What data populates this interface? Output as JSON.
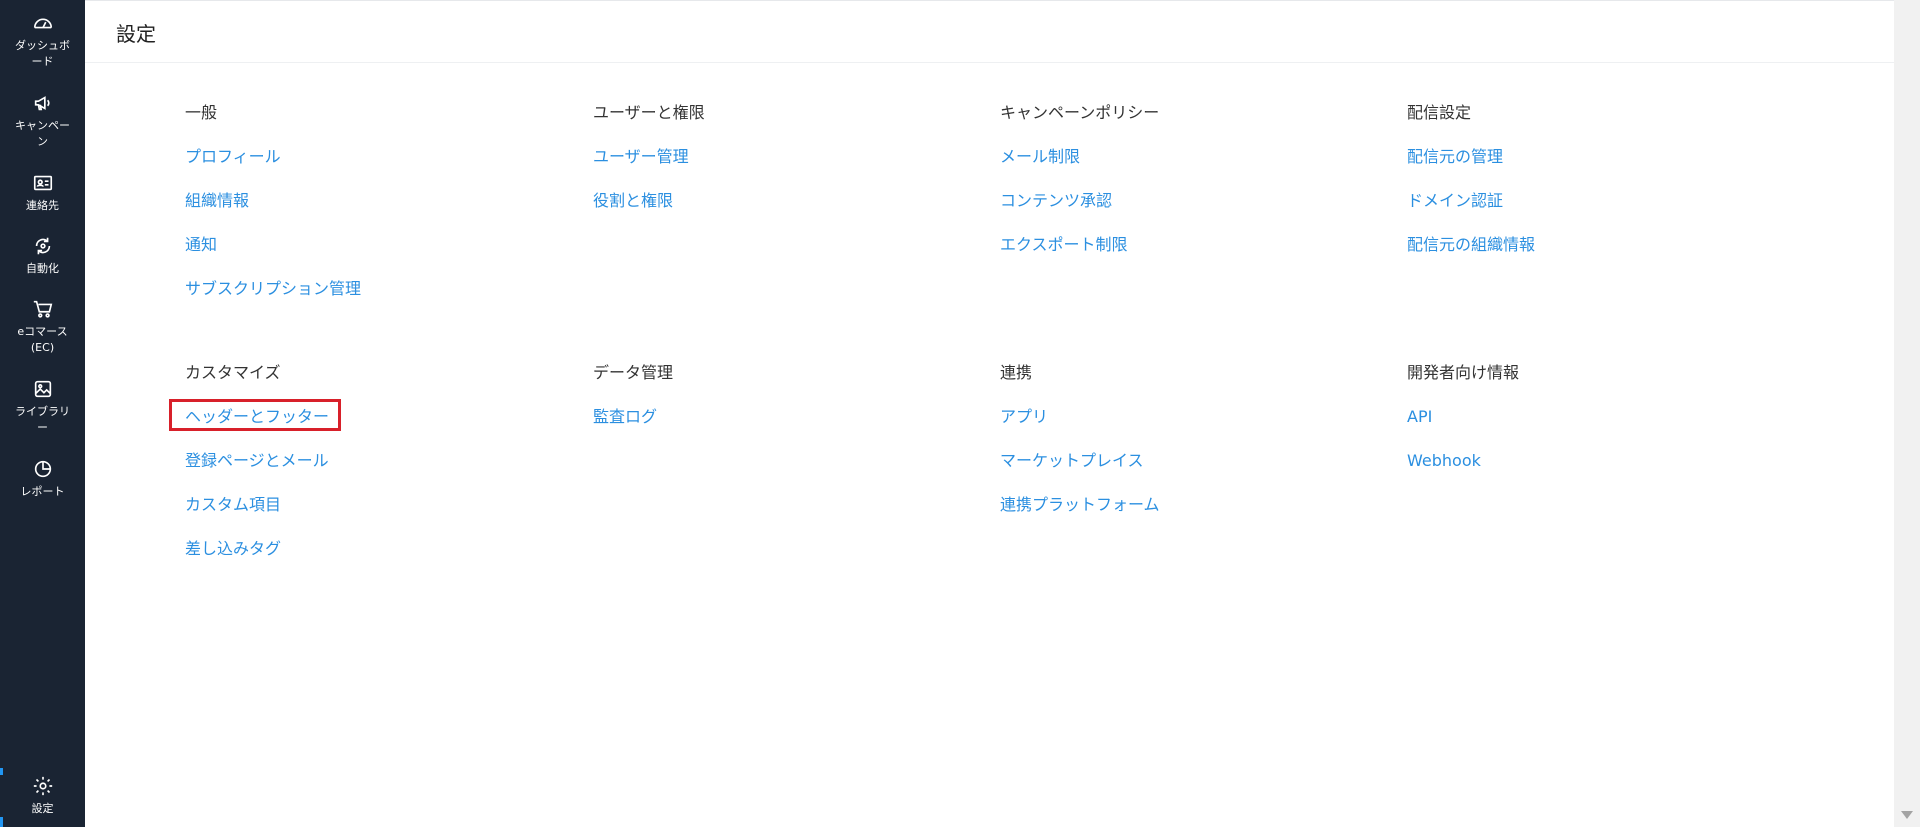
{
  "sidebar": {
    "items": [
      {
        "label": "ダッシュボード",
        "icon": "gauge-icon"
      },
      {
        "label": "キャンペーン",
        "icon": "megaphone-icon"
      },
      {
        "label": "連絡先",
        "icon": "contact-card-icon"
      },
      {
        "label": "自動化",
        "icon": "automation-icon"
      },
      {
        "label": "eコマース (EC)",
        "icon": "cart-icon"
      },
      {
        "label": "ライブラリー",
        "icon": "image-library-icon"
      },
      {
        "label": "レポート",
        "icon": "pie-chart-icon"
      },
      {
        "label": "設定",
        "icon": "gear-icon",
        "active": true
      }
    ]
  },
  "header": {
    "title": "設定"
  },
  "sections": [
    {
      "title": "一般",
      "links": [
        "プロフィール",
        "組織情報",
        "通知",
        "サブスクリプション管理"
      ]
    },
    {
      "title": "ユーザーと権限",
      "links": [
        "ユーザー管理",
        "役割と権限"
      ]
    },
    {
      "title": "キャンペーンポリシー",
      "links": [
        "メール制限",
        "コンテンツ承認",
        "エクスポート制限"
      ]
    },
    {
      "title": "配信設定",
      "links": [
        "配信元の管理",
        "ドメイン認証",
        "配信元の組織情報"
      ]
    },
    {
      "title": "カスタマイズ",
      "links": [
        "ヘッダーとフッター",
        "登録ページとメール",
        "カスタム項目",
        "差し込みタグ"
      ]
    },
    {
      "title": "データ管理",
      "links": [
        "監査ログ"
      ]
    },
    {
      "title": "連携",
      "links": [
        "アプリ",
        "マーケットプレイス",
        "連携プラットフォーム"
      ]
    },
    {
      "title": "開発者向け情報",
      "links": [
        "API",
        "Webhook"
      ]
    }
  ],
  "colors": {
    "sidebar_bg": "#1a2433",
    "link": "#2b8fe0",
    "highlight": "#d8202a",
    "active_indicator": "#2196f3"
  }
}
